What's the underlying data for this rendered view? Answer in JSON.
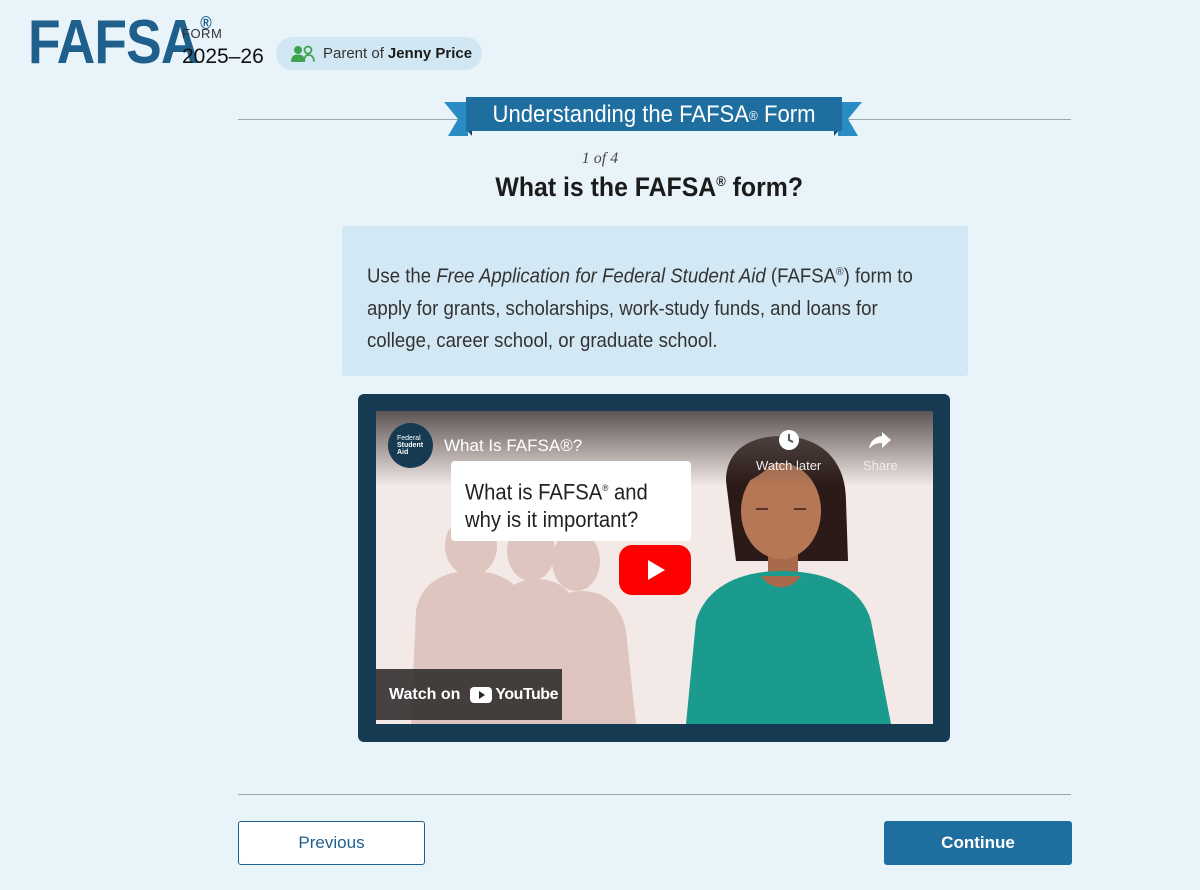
{
  "header": {
    "logo_text": "FAFSA",
    "logo_mark": "®",
    "form_label": "FORM",
    "form_year": "2025–26",
    "role_prefix": "Parent of",
    "role_name": "Jenny Price",
    "role_icon": "users-icon"
  },
  "section": {
    "ribbon_text": "Understanding the FAFSA",
    "ribbon_mark": "®",
    "ribbon_suffix": " Form",
    "step": "1 of 4",
    "heading_pre": "What is the FAFSA",
    "heading_mark": "®",
    "heading_post": " form?"
  },
  "info": {
    "p1": "Use the ",
    "p_italic": "Free Application for Federal Student Aid",
    "p2": " (FAFSA",
    "p_mark": "®",
    "p3": ") form to apply for grants, scholarships, work-study funds, and loans for college, career school, or graduate school."
  },
  "video": {
    "channel_line1": "Federal",
    "channel_line2": "Student",
    "channel_line3": "Aid",
    "title": "What Is FAFSA®?",
    "watch_later": "Watch later",
    "share": "Share",
    "card_line1": "What is FAFSA",
    "card_mark": "®",
    "card_line1_end": " and",
    "card_line2": "why is it important?",
    "watch_on": "Watch on",
    "youtube": "YouTube"
  },
  "footer": {
    "previous": "Previous",
    "continue": "Continue"
  },
  "colors": {
    "background": "#e8f3fa",
    "brand": "#1f5f8b",
    "primary_button": "#1f6ea0",
    "info_box": "#d2e8f5",
    "role_icon": "#3fa34d"
  }
}
